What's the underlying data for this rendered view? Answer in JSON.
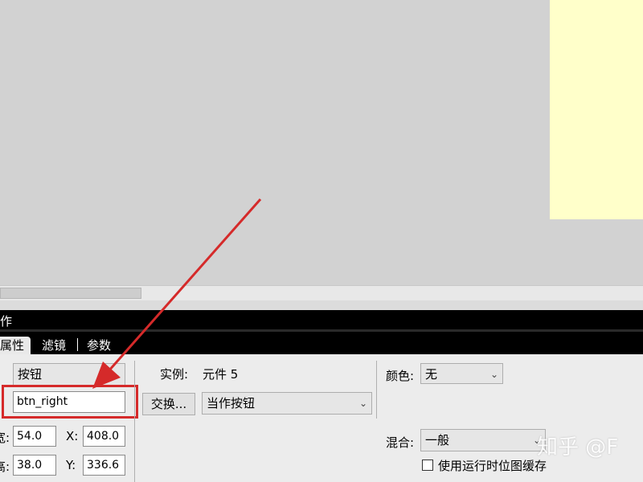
{
  "panel": {
    "title": "作"
  },
  "tabs": [
    "属性",
    "滤镜",
    "参数"
  ],
  "instance": {
    "type_value": "按钮",
    "name_value": "btn_right",
    "instance_label": "实例:",
    "instance_value": "元件 5",
    "swap_label": "交换...",
    "behavior_value": "当作按钮"
  },
  "geometry": {
    "w_label": "宽:",
    "w_value": "54.0",
    "h_label": "高:",
    "h_value": "38.0",
    "x_label": "X:",
    "x_value": "408.0",
    "y_label": "Y:",
    "y_value": "336.6"
  },
  "color": {
    "label": "颜色:",
    "value": "无"
  },
  "blend": {
    "label": "混合:",
    "value": "一般"
  },
  "cache": {
    "label": "使用运行时位图缓存"
  },
  "watermark": "知乎 @F",
  "colors": {
    "annotation_red": "#d52a2a",
    "stage_bg": "#ffffca"
  }
}
